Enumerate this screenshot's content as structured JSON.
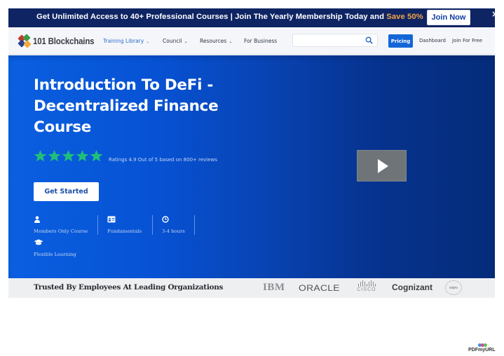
{
  "promo": {
    "text_before": "Get Unlimited Access to 40+ Professional Courses | Join The Yearly Membership Today and ",
    "highlight": "Save 50%",
    "cta_label": "Join Now",
    "close_icon": "×",
    "background_color": "#0e2463",
    "highlight_color": "#f0a448"
  },
  "navbar": {
    "logo_text": "101 Blockchains",
    "items": [
      {
        "label": "Training Library",
        "dropdown": true,
        "active": true
      },
      {
        "label": "Council",
        "dropdown": true,
        "active": false
      },
      {
        "label": "Resources",
        "dropdown": true,
        "active": false
      },
      {
        "label": "For Business",
        "dropdown": false,
        "active": false
      }
    ],
    "chevron": "⌄",
    "search": {
      "value": "",
      "placeholder": ""
    },
    "pricing_label": "Pricing",
    "dashboard_label": "Dashboard",
    "join_label": "Join For Free",
    "accent_color": "#1466d8"
  },
  "hero": {
    "title": "Introduction To DeFi - Decentralized Finance Course",
    "rating": {
      "value": 4.9,
      "max": 5,
      "stars_filled": 5,
      "text": "Ratings 4.9 Out of 5 based on 800+ reviews",
      "star_color": "#1fbf7a"
    },
    "cta_label": "Get Started",
    "meta": [
      {
        "icon": "user-icon",
        "label": "Members Only Course"
      },
      {
        "icon": "id-card-icon",
        "label": "Fundamentals"
      },
      {
        "icon": "clock-icon",
        "label": "3-4 hours"
      },
      {
        "icon": "graduation-cap-icon",
        "label": "Flexible Learning"
      }
    ],
    "video": {
      "icon": "play-icon"
    }
  },
  "trusted": {
    "title": "Trusted By Employees At Leading Organizations",
    "brands": [
      "IBM",
      "ORACLE",
      "CISCO",
      "Cognizant",
      "wipro"
    ]
  },
  "watermark": "PDFmyURL"
}
